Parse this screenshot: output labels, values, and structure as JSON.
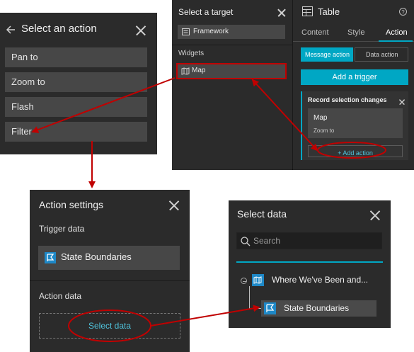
{
  "select_action": {
    "title": "Select an action",
    "items": [
      "Pan to",
      "Zoom to",
      "Flash",
      "Filter"
    ]
  },
  "select_target": {
    "title": "Select a target",
    "framework_label": "Framework",
    "widgets_heading": "Widgets",
    "map_label": "Map"
  },
  "table_settings": {
    "title": "Table",
    "tabs": [
      "Content",
      "Style",
      "Action"
    ],
    "active_tab": "Action",
    "subtabs": [
      "Message action",
      "Data action"
    ],
    "add_trigger_label": "Add a trigger",
    "record_card": {
      "title": "Record selection changes",
      "target": "Map",
      "action": "Zoom to",
      "add_action_label": "+ Add action"
    }
  },
  "action_settings": {
    "title": "Action settings",
    "trigger_heading": "Trigger data",
    "trigger_value": "State Boundaries",
    "action_heading": "Action data",
    "select_data_label": "Select data"
  },
  "select_data": {
    "title": "Select data",
    "search_placeholder": "Search",
    "tree_parent": "Where We've Been and...",
    "tree_child": "State Boundaries"
  },
  "colors": {
    "panel_bg": "#2b2b2b",
    "item_bg": "#474747",
    "accent_teal": "#00a7c4",
    "annotation_red": "#c00000",
    "layer_blue": "#1e88c7"
  }
}
